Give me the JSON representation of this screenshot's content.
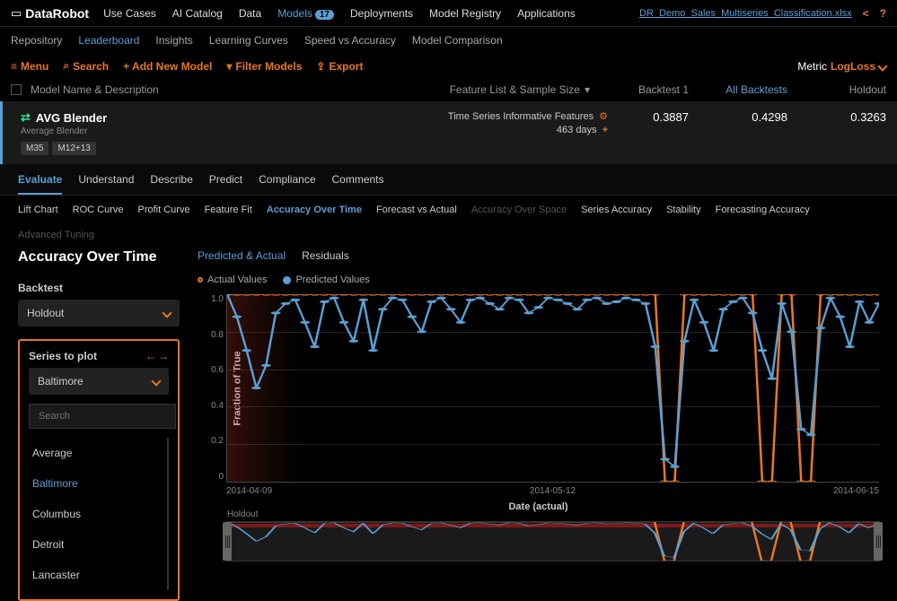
{
  "brand": {
    "pre": "Data",
    "post": "Robot"
  },
  "topnav": {
    "usecases": "Use Cases",
    "aicatalog": "AI Catalog",
    "data": "Data",
    "models": "Models",
    "models_badge": "17",
    "deployments": "Deployments",
    "registry": "Model Registry",
    "apps": "Applications"
  },
  "filename": "DR_Demo_Sales_Multiseries_Classification.xlsx",
  "help": "?",
  "subnav": {
    "repo": "Repository",
    "leaderboard": "Leaderboard",
    "insights": "Insights",
    "learning": "Learning Curves",
    "speed": "Speed vs Accuracy",
    "compare": "Model Comparison"
  },
  "toolbar": {
    "menu": "Menu",
    "search": "Search",
    "add": "+ Add New Model",
    "filter": "Filter Models",
    "export": "Export",
    "metric_label": "Metric",
    "metric_value": "LogLoss"
  },
  "headers": {
    "name": "Model Name & Description",
    "feature": "Feature List & Sample Size",
    "b1": "Backtest 1",
    "all": "All Backtests",
    "holdout": "Holdout"
  },
  "model": {
    "name": "AVG Blender",
    "sub": "Average Blender",
    "tag1": "M35",
    "tag2": "M12+13",
    "feature_name": "Time Series Informative Features",
    "feature_days": "463 days",
    "score_b1": "0.3887",
    "score_all": "0.4298",
    "score_hold": "0.3263"
  },
  "model_tabs": {
    "evaluate": "Evaluate",
    "understand": "Understand",
    "describe": "Describe",
    "predict": "Predict",
    "compliance": "Compliance",
    "comments": "Comments"
  },
  "eval_tabs": {
    "lift": "Lift Chart",
    "roc": "ROC Curve",
    "profit": "Profit Curve",
    "fit": "Feature Fit",
    "aot": "Accuracy Over Time",
    "fva": "Forecast vs Actual",
    "aos": "Accuracy Over Space",
    "series": "Series Accuracy",
    "stability": "Stability",
    "facc": "Forecasting Accuracy",
    "tuning": "Advanced Tuning"
  },
  "page_title": "Accuracy Over Time",
  "controls": {
    "backtest_label": "Backtest",
    "backtest_value": "Holdout",
    "series_label": "Series to plot",
    "series_value": "Baltimore",
    "search_placeholder": "Search",
    "options": {
      "avg": "Average",
      "baltimore": "Baltimore",
      "columbus": "Columbus",
      "detroit": "Detroit",
      "lancaster": "Lancaster"
    }
  },
  "chart_tabs": {
    "pa": "Predicted & Actual",
    "res": "Residuals"
  },
  "legend": {
    "actual": "Actual Values",
    "predicted": "Predicted Values"
  },
  "axes": {
    "y": "Fraction of True",
    "x": "Date (actual)",
    "x0": "2014-04-09",
    "x1": "2014-05-12",
    "x2": "2014-06-15",
    "mini": "Holdout"
  },
  "chart_data": {
    "type": "line",
    "title": "Accuracy Over Time",
    "xlabel": "Date (actual)",
    "ylabel": "Fraction of True",
    "ylim": [
      0,
      1.0
    ],
    "x_range": [
      "2014-04-09",
      "2014-06-15"
    ],
    "series": [
      {
        "name": "Actual Values",
        "color": "#e87722",
        "values": [
          1,
          1,
          1,
          1,
          1,
          1,
          1,
          1,
          1,
          1,
          1,
          1,
          1,
          1,
          1,
          1,
          1,
          1,
          1,
          1,
          1,
          1,
          1,
          1,
          1,
          1,
          1,
          1,
          1,
          1,
          1,
          1,
          1,
          1,
          1,
          1,
          1,
          1,
          1,
          1,
          1,
          1,
          1,
          1,
          1,
          0,
          0,
          1,
          1,
          1,
          1,
          1,
          1,
          1,
          1,
          0,
          0,
          1,
          1,
          0,
          0,
          1,
          1,
          1,
          1,
          1,
          1,
          1
        ]
      },
      {
        "name": "Predicted Values",
        "color": "#5a9fd4",
        "values": [
          1,
          0.88,
          0.7,
          0.5,
          0.62,
          0.9,
          0.95,
          0.97,
          0.85,
          0.72,
          0.96,
          0.98,
          0.85,
          0.75,
          0.97,
          0.7,
          0.92,
          0.98,
          0.97,
          0.88,
          0.8,
          0.96,
          0.98,
          0.92,
          0.85,
          0.97,
          0.98,
          0.95,
          0.92,
          0.98,
          0.97,
          0.9,
          0.93,
          0.98,
          0.97,
          0.95,
          0.92,
          0.97,
          0.98,
          0.95,
          0.96,
          0.98,
          0.97,
          0.95,
          0.72,
          0.12,
          0.08,
          0.75,
          0.97,
          0.85,
          0.7,
          0.92,
          0.96,
          0.98,
          0.9,
          0.7,
          0.55,
          0.95,
          0.8,
          0.28,
          0.25,
          0.82,
          0.98,
          0.88,
          0.72,
          0.96,
          0.85,
          0.95
        ]
      }
    ]
  }
}
